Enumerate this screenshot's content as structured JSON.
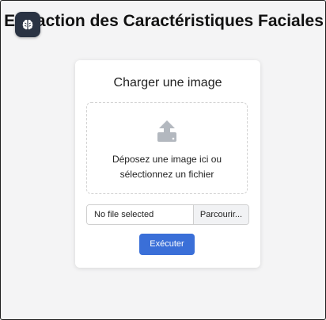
{
  "header": {
    "title": "Extraction des Caractéristiques Faciales",
    "badge_icon": "brain-icon"
  },
  "upload": {
    "title": "Charger une image",
    "dropzone_icon": "upload-icon",
    "dropzone_line1": "Déposez une image ici ou",
    "dropzone_line2": "sélectionnez un fichier",
    "file_status": "No file selected",
    "browse_label": "Parcourir...",
    "submit_label": "Exécuter"
  },
  "colors": {
    "primary": "#3a6fd8",
    "badge_bg": "#2a3343",
    "icon_gray": "#b3b8bf"
  }
}
